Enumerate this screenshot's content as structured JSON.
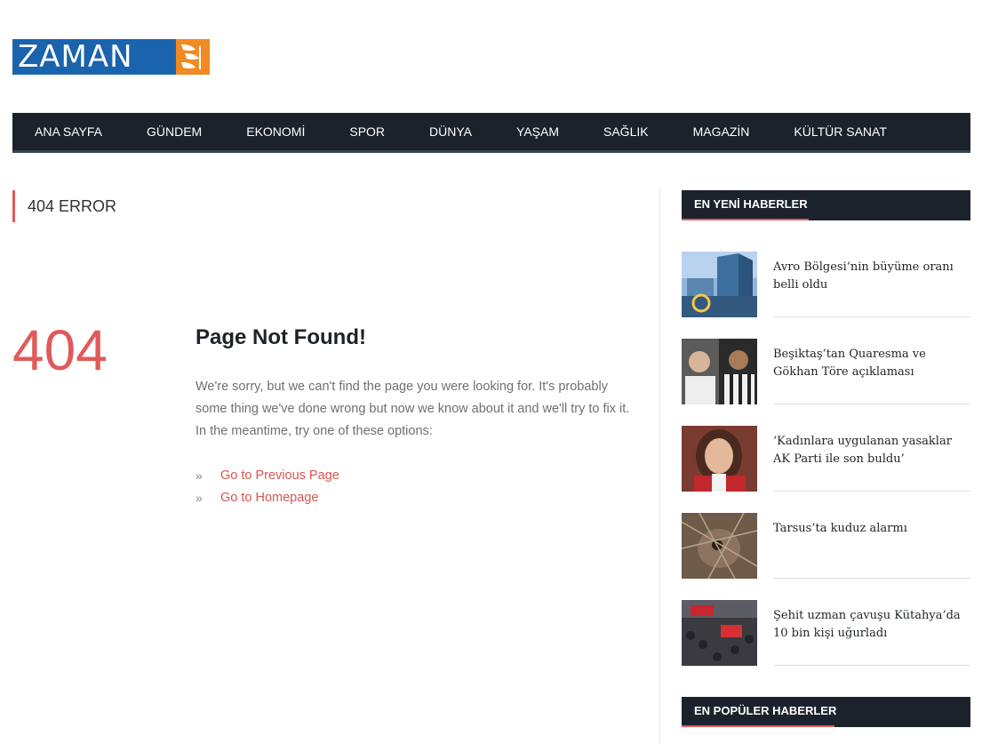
{
  "logo": {
    "text": "ZAMAN",
    "brand_color": "#1a63ad",
    "accent_color": "#f08a24"
  },
  "nav": {
    "items": [
      "ANA SAYFA",
      "GÜNDEM",
      "EKONOMİ",
      "SPOR",
      "DÜNYA",
      "YAŞAM",
      "SAĞLIK",
      "MAGAZİN",
      "KÜLTÜR SANAT"
    ]
  },
  "main": {
    "page_title": "404 ERROR",
    "error_code": "404",
    "heading": "Page Not Found!",
    "message": "We're sorry, but we can't find the page you were looking for. It's probably some thing we've done wrong but now we know about it and we'll try to fix it. In the meantime, try one of these options:",
    "link_bullet": "»",
    "links": [
      "Go to Previous Page",
      "Go to Homepage"
    ]
  },
  "sidebar": {
    "latest_title": "EN YENİ HABERLER",
    "popular_title": "EN POPÜLER HABERLER",
    "news": [
      {
        "title": "Avro Bölgesi’nin büyüme oranı belli oldu",
        "thumb": "building-photo"
      },
      {
        "title": "Beşiktaş’tan Quaresma ve Gökhan Töre açıklaması",
        "thumb": "footballers-photo"
      },
      {
        "title": "‘Kadınlara uygulanan yasaklar AK Parti ile son buldu’",
        "thumb": "woman-portrait-photo"
      },
      {
        "title": "Tarsus’ta kuduz alarmı",
        "thumb": "dog-cage-photo"
      },
      {
        "title": "Şehit uzman çavuşu Kütahya’da 10 bin kişi uğurladı",
        "thumb": "crowd-funeral-photo"
      }
    ]
  },
  "colors": {
    "nav_bg": "#1b222c",
    "accent": "#e05a5a",
    "link": "#d9534f"
  }
}
